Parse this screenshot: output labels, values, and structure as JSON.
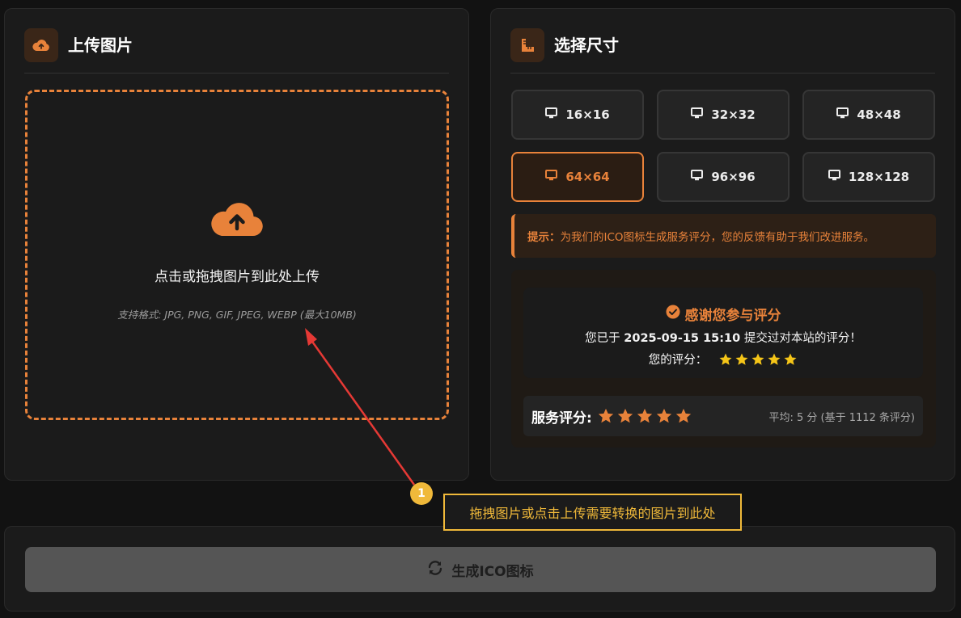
{
  "upload": {
    "title": "上传图片",
    "drop_text": "点击或拖拽图片到此处上传",
    "hint": "支持格式: JPG, PNG, GIF, JPEG, WEBP (最大10MB)"
  },
  "size": {
    "title": "选择尺寸",
    "options": [
      {
        "label": "16×16",
        "active": false
      },
      {
        "label": "32×32",
        "active": false
      },
      {
        "label": "48×48",
        "active": false
      },
      {
        "label": "64×64",
        "active": true
      },
      {
        "label": "96×96",
        "active": false
      },
      {
        "label": "128×128",
        "active": false
      }
    ]
  },
  "tip": {
    "label": "提示：",
    "text": "为我们的ICO图标生成服务评分，您的反馈有助于我们改进服务。"
  },
  "rating": {
    "thanks_title": "感谢您参与评分",
    "submitted_prefix": "您已于",
    "submitted_time": "2025-09-15 15:10",
    "submitted_suffix": "提交过对本站的评分！",
    "your_rating_label": "您的评分：",
    "your_rating_stars": 5,
    "service_label": "服务评分:",
    "service_stars": 5,
    "average_text": "平均: 5 分 (基于 1112 条评分)"
  },
  "action": {
    "generate_label": "生成ICO图标"
  },
  "annotation": {
    "number": "1",
    "text": "拖拽图片或点击上传需要转换的图片到此处"
  },
  "colors": {
    "accent": "#e8823a",
    "star": "#f5c518",
    "annotation": "#f0b93a"
  }
}
